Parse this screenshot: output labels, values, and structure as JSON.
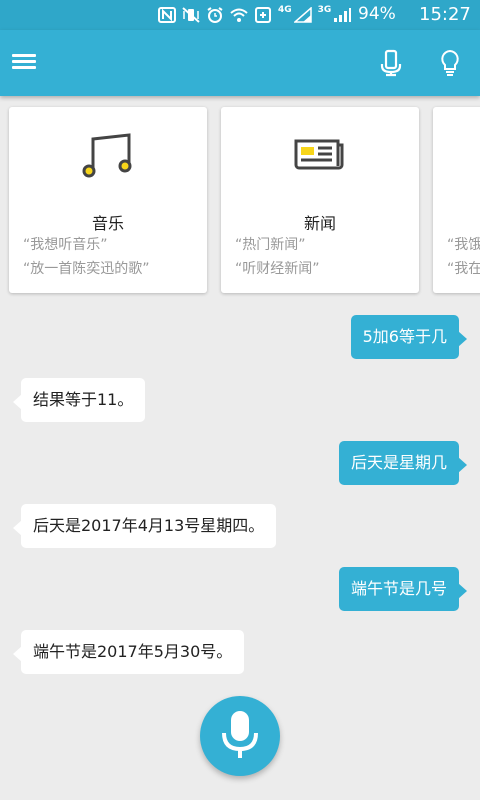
{
  "status_bar": {
    "net1": "4G",
    "net2": "3G",
    "battery": "94%",
    "time": "15:27"
  },
  "toolbar": {
    "menu_icon": "hamburger-menu-icon",
    "mic_icon": "microphone-icon",
    "tips_icon": "lightbulb-icon"
  },
  "cards": [
    {
      "icon": "music-note-icon",
      "title": "音乐",
      "examples": [
        "“我想听音乐”",
        "“放一首陈奕迅的歌”"
      ]
    },
    {
      "icon": "newspaper-icon",
      "title": "新闻",
      "examples": [
        "“热门新闻”",
        "“听财经新闻”"
      ]
    },
    {
      "icon": "",
      "title": "",
      "examples": [
        "“我饿",
        "“我在"
      ]
    }
  ],
  "messages": [
    {
      "from": "user",
      "text": "5加6等于几"
    },
    {
      "from": "bot",
      "text": "结果等于11。"
    },
    {
      "from": "user",
      "text": "后天是星期几"
    },
    {
      "from": "bot",
      "text": "后天是2017年4月13号星期四。"
    },
    {
      "from": "user",
      "text": "端午节是几号"
    },
    {
      "from": "bot",
      "text": "端午节是2017年5月30号。"
    }
  ],
  "fab": {
    "icon": "microphone-icon"
  },
  "colors": {
    "status_bar": "#2fa7c9",
    "toolbar": "#34b0d4",
    "accent": "#34b0d4",
    "background": "#ececec",
    "icon_yellow": "#f7d51a"
  }
}
